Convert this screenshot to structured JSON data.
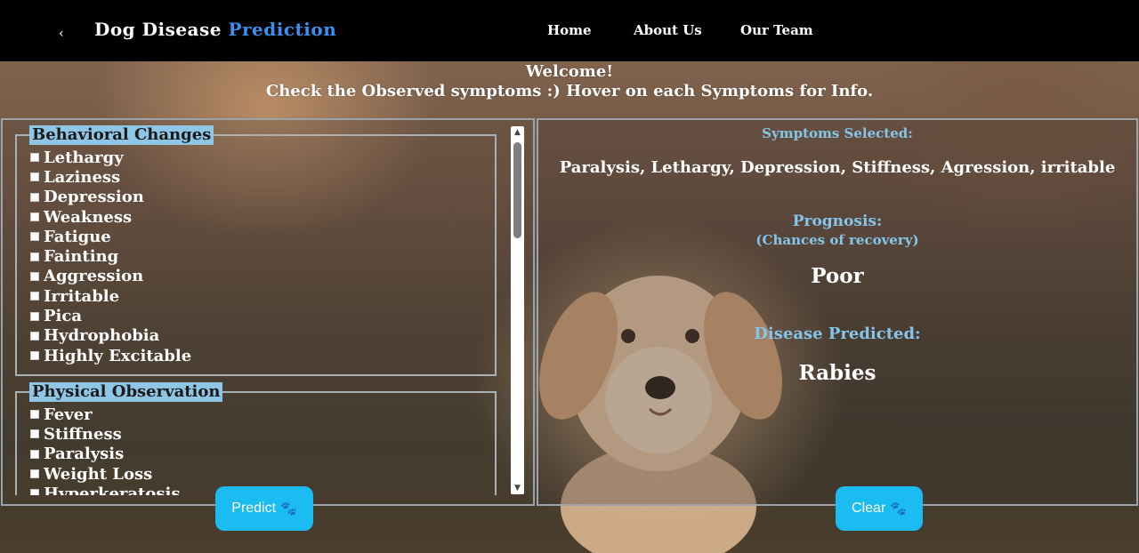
{
  "navbar": {
    "back_icon": "‹",
    "brand_main": "Dog Disease",
    "brand_accent": "Prediction",
    "links": [
      "Home",
      "About Us",
      "Our Team"
    ]
  },
  "welcome": {
    "line1": "Welcome!",
    "line2": "Check the Observed symptoms :) Hover on each Symptoms for Info."
  },
  "symptom_groups": [
    {
      "title": "Behavioral Changes",
      "items": [
        "Lethargy",
        "Laziness",
        "Depression",
        "Weakness",
        "Fatigue",
        "Fainting",
        "Aggression",
        "Irritable",
        "Pica",
        "Hydrophobia",
        "Highly Excitable"
      ]
    },
    {
      "title": "Physical Observation",
      "items": [
        "Fever",
        "Stiffness",
        "Paralysis",
        "Weight Loss",
        "Hyperkeratosis"
      ]
    }
  ],
  "result": {
    "symptoms_label": "Symptoms Selected:",
    "symptoms_value": "Paralysis, Lethargy, Depression, Stiffness, Agression, irritable",
    "prognosis_label": "Prognosis:",
    "prognosis_sub": "(Chances of recovery)",
    "prognosis_value": "Poor",
    "disease_label": "Disease Predicted:",
    "disease_value": "Rabies"
  },
  "buttons": {
    "predict": "Predict",
    "clear": "Clear",
    "paw_icon": "paw-icon"
  },
  "colors": {
    "accent": "#3b8ff0",
    "legend_bg": "#8fc6e6",
    "label_blue": "#86c5ea",
    "button": "#1bbcf2"
  }
}
